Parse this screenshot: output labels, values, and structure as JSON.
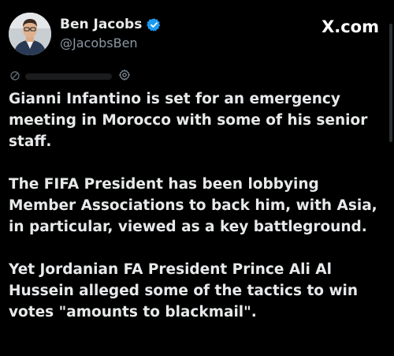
{
  "author": {
    "display_name": "Ben Jacobs",
    "handle": "@JacobsBen",
    "verified": true
  },
  "brand": {
    "label": "X.com"
  },
  "icons": {
    "avatar": "profile-photo",
    "verified": "verified-badge-icon",
    "meta_left": "link-icon",
    "meta_right": "settings-icon"
  },
  "colors": {
    "background": "#000000",
    "text": "#e7e9ea",
    "secondary": "#8b98a5",
    "verified": "#1d9bf0"
  },
  "tweet": {
    "paragraphs": [
      "Gianni Infantino is set for an emergency meeting in Morocco with some of his senior staff.",
      "The FIFA President has been lobbying Member Associations to back him, with Asia, in particular, viewed as a key battleground.",
      "Yet Jordanian FA President Prince Ali Al Hussein alleged some of the tactics to win votes \"amounts to blackmail\"."
    ]
  }
}
